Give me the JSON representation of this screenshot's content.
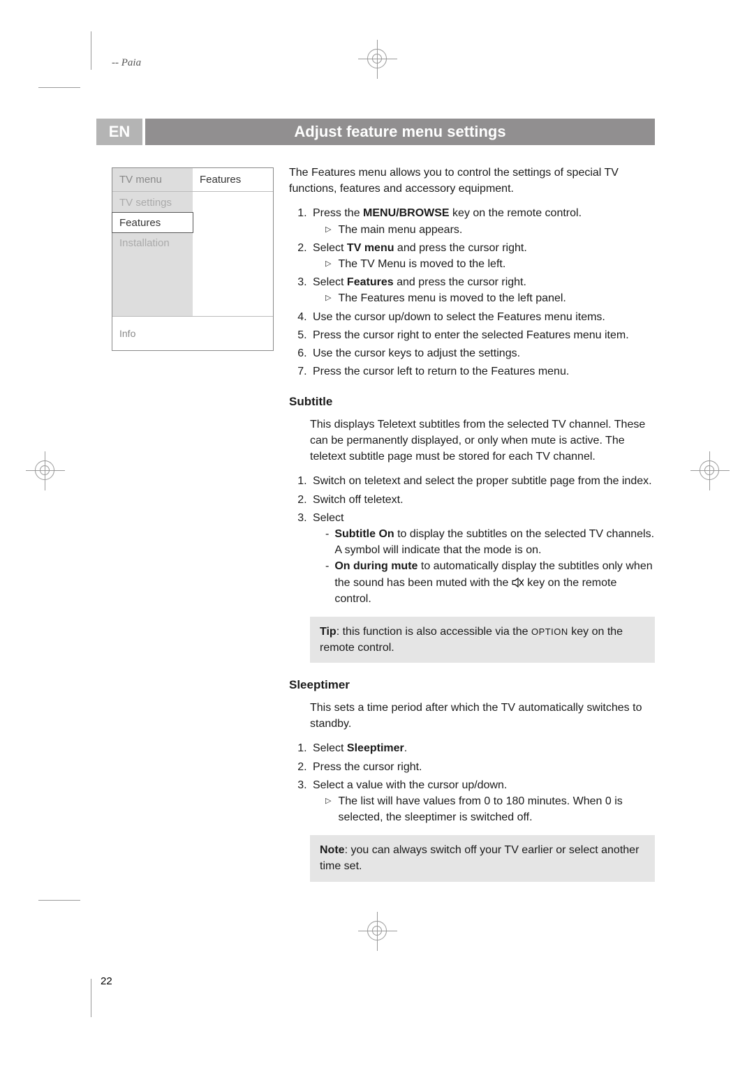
{
  "header": {
    "left_text": "--   Paia"
  },
  "lang": "EN",
  "title": "Adjust feature menu settings",
  "menu": {
    "left_header": "TV menu",
    "right_header": "Features",
    "items": [
      {
        "label": "TV settings",
        "selected": false
      },
      {
        "label": "Features",
        "selected": true
      },
      {
        "label": "Installation",
        "selected": false
      }
    ],
    "info": "Info"
  },
  "intro": "The Features menu allows you to control the settings of special TV functions, features and accessory equipment.",
  "steps": [
    {
      "pre": "Press the ",
      "bold": "MENU/BROWSE",
      "post": " key on the remote control.",
      "result": "The main menu appears."
    },
    {
      "pre": "Select ",
      "bold": "TV menu",
      "post": " and press the cursor right.",
      "result": "The TV Menu is moved to the left."
    },
    {
      "pre": "Select ",
      "bold": "Features",
      "post": " and press the cursor right.",
      "result": "The Features menu is moved to the left panel."
    },
    {
      "text": "Use the cursor up/down to select the Features menu items."
    },
    {
      "text": "Press the cursor right to enter the selected Features menu item."
    },
    {
      "text": "Use the cursor keys to adjust the settings."
    },
    {
      "text": "Press the cursor left to return to the Features menu."
    }
  ],
  "subtitle": {
    "heading": "Subtitle",
    "intro": "This displays Teletext subtitles from the selected TV channel. These can be permanently displayed, or only when mute is active. The teletext subtitle page must be stored for each TV channel.",
    "steps": [
      "Switch on teletext and select the proper subtitle page from the index.",
      "Switch off teletext.",
      "Select"
    ],
    "options": [
      {
        "bold": "Subtitle On",
        "text": " to display the subtitles on the selected TV channels.  A symbol will indicate that the mode is on."
      },
      {
        "bold": "On during mute",
        "text_pre": " to automatically display the subtitles only when the sound has been muted with the ",
        "text_post": " key on the remote control."
      }
    ],
    "tip_label": "Tip",
    "tip_text": ": this function is also accessible via the ",
    "tip_key": "OPTION",
    "tip_post": " key on the remote control."
  },
  "sleeptimer": {
    "heading": "Sleeptimer",
    "intro": "This sets a time period after which the TV automatically switches to standby.",
    "steps": [
      {
        "pre": "Select ",
        "bold": "Sleeptimer",
        "post": "."
      },
      {
        "text": "Press the cursor right."
      },
      {
        "text": "Select a value with the cursor up/down.",
        "result": "The list will have values from 0 to 180 minutes. When 0 is selected, the sleeptimer is switched off."
      }
    ],
    "note_label": "Note",
    "note_text": ": you can always switch off your TV earlier or select another time set."
  },
  "page_number": "22"
}
